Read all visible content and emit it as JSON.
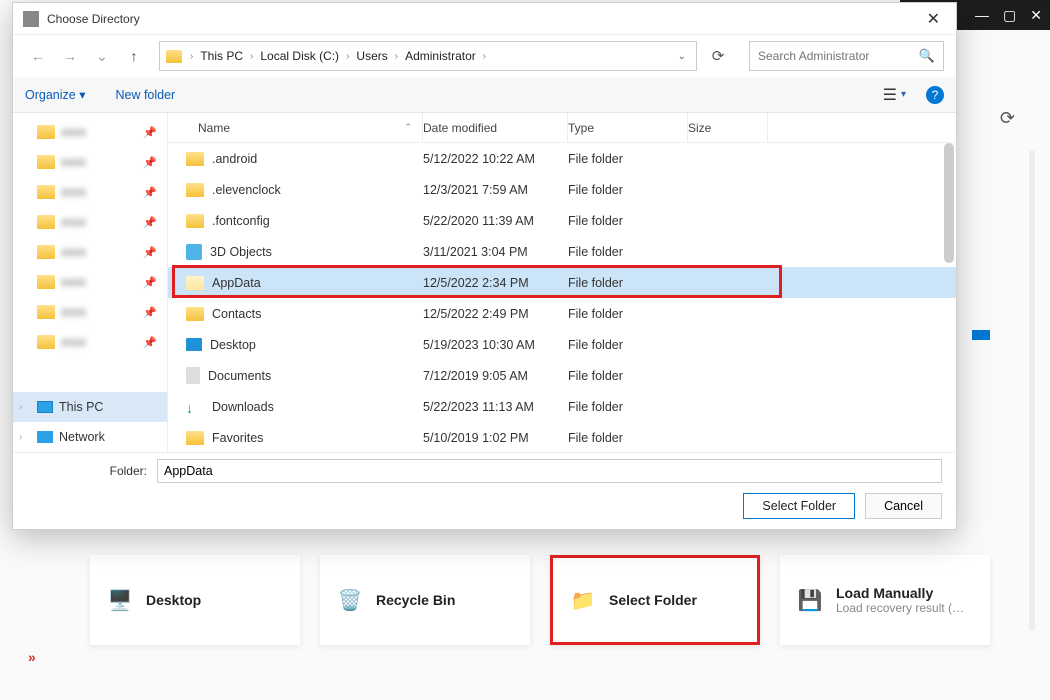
{
  "bg": {
    "minimize": "—",
    "maximize": "▢",
    "close": "✕"
  },
  "cards": {
    "desktop": "Desktop",
    "recycle": "Recycle Bin",
    "select_folder": "Select Folder",
    "load_manually": "Load Manually",
    "load_sub": "Load recovery result (*…"
  },
  "dialog": {
    "title": "Choose Directory",
    "nav": {
      "back": "←",
      "fwd": "→",
      "up": "↑"
    },
    "breadcrumb": [
      "This PC",
      "Local Disk (C:)",
      "Users",
      "Administrator"
    ],
    "search_placeholder": "Search Administrator",
    "toolbar": {
      "organize": "Organize ▾",
      "newfolder": "New folder"
    },
    "columns": {
      "name": "Name",
      "date": "Date modified",
      "type": "Type",
      "size": "Size"
    },
    "tree_bottom": {
      "pc": "This PC",
      "net": "Network"
    },
    "rows": [
      {
        "name": ".android",
        "date": "5/12/2022 10:22 AM",
        "type": "File folder",
        "icon": "folder"
      },
      {
        "name": ".elevenclock",
        "date": "12/3/2021 7:59 AM",
        "type": "File folder",
        "icon": "folder"
      },
      {
        "name": ".fontconfig",
        "date": "5/22/2020 11:39 AM",
        "type": "File folder",
        "icon": "folder"
      },
      {
        "name": "3D Objects",
        "date": "3/11/2021 3:04 PM",
        "type": "File folder",
        "icon": "cube"
      },
      {
        "name": "AppData",
        "date": "12/5/2022 2:34 PM",
        "type": "File folder",
        "icon": "pale",
        "selected": true
      },
      {
        "name": "Contacts",
        "date": "12/5/2022 2:49 PM",
        "type": "File folder",
        "icon": "folder"
      },
      {
        "name": "Desktop",
        "date": "5/19/2023 10:30 AM",
        "type": "File folder",
        "icon": "desk"
      },
      {
        "name": "Documents",
        "date": "7/12/2019 9:05 AM",
        "type": "File folder",
        "icon": "doc"
      },
      {
        "name": "Downloads",
        "date": "5/22/2023 11:13 AM",
        "type": "File folder",
        "icon": "down"
      },
      {
        "name": "Favorites",
        "date": "5/10/2019 1:02 PM",
        "type": "File folder",
        "icon": "folder"
      }
    ],
    "folder_label": "Folder:",
    "folder_value": "AppData",
    "select_btn": "Select Folder",
    "cancel_btn": "Cancel"
  }
}
